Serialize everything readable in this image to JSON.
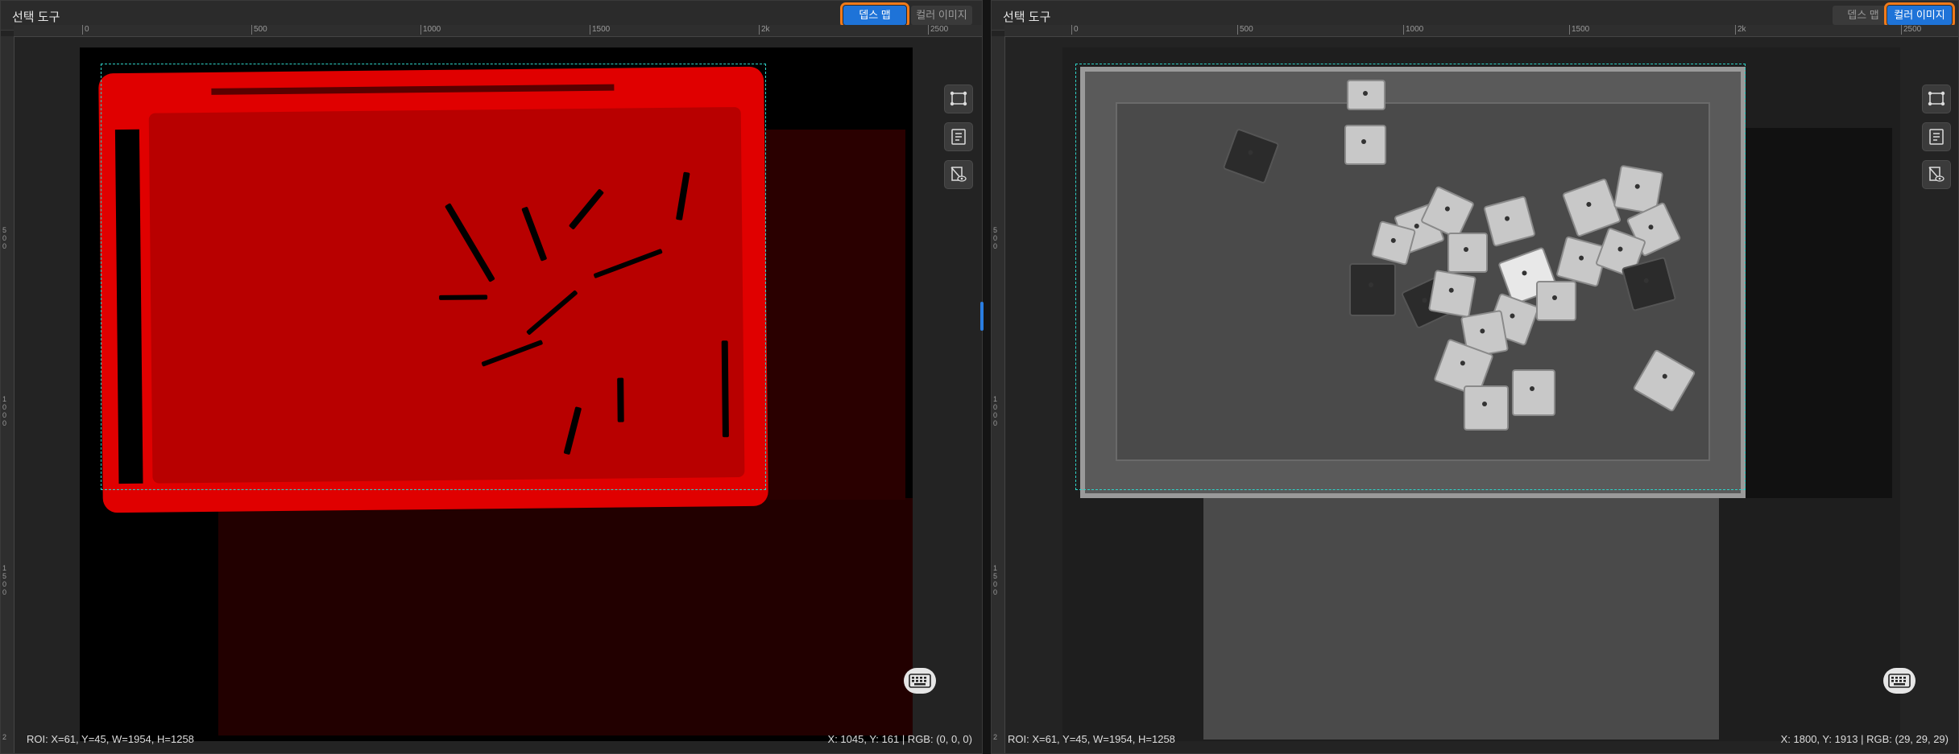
{
  "left_panel": {
    "title": "선택 도구",
    "tabs": [
      {
        "label": "뎁스 맵",
        "active": true,
        "highlighted": true
      },
      {
        "label": "컬러 이미지",
        "active": false,
        "highlighted": false
      }
    ],
    "ruler_top": [
      "0",
      "500",
      "1000",
      "1500",
      "2k",
      "2500"
    ],
    "ruler_left": [
      "500",
      "1000",
      "1500",
      "2"
    ],
    "roi_text": "ROI: X=61, Y=45, W=1954, H=1258",
    "cursor_text": "X: 1045, Y: 161 | RGB: (0, 0, 0)"
  },
  "right_panel": {
    "title": "선택 도구",
    "tabs": [
      {
        "label": "뎁스 맵",
        "active": false,
        "highlighted": false
      },
      {
        "label": "컬러 이미지",
        "active": true,
        "highlighted": true
      }
    ],
    "ruler_top": [
      "0",
      "500",
      "1000",
      "1500",
      "2k",
      "2500"
    ],
    "ruler_left": [
      "500",
      "1000",
      "1500",
      "2"
    ],
    "roi_text": "ROI: X=61, Y=45, W=1954, H=1258",
    "cursor_text": "X: 1800, Y: 1913 | RGB: (29, 29, 29)"
  },
  "icons": {
    "roi": "roi-polygon-icon",
    "list": "checklist-icon",
    "visibility": "image-eye-icon",
    "keyboard": "keyboard-icon"
  },
  "colors": {
    "accent": "#1e73d8",
    "highlight": "#f07a1a",
    "roi": "#2fd3c8",
    "depth": "#d40000"
  }
}
